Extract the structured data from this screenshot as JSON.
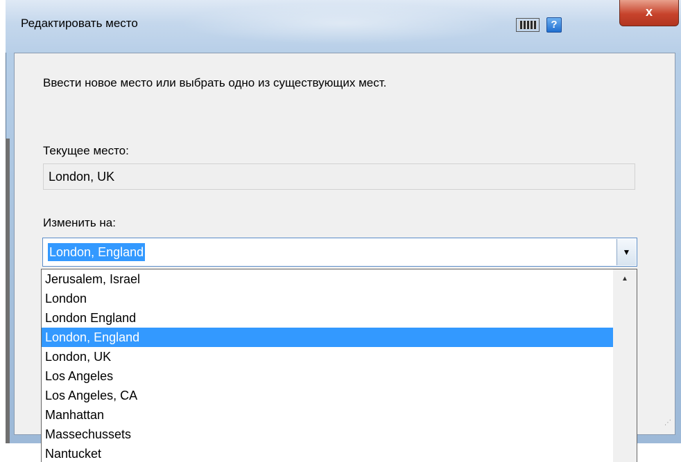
{
  "window": {
    "title": "Редактировать место",
    "close_label": "x",
    "help_label": "?",
    "icons": [
      "keyboard-icon",
      "help-icon",
      "close-icon"
    ]
  },
  "content": {
    "instruction": "Ввести новое место или выбрать одно из существующих мест.",
    "current_label": "Текущее место:",
    "current_value": "London, UK",
    "change_label": "Изменить на:",
    "change_value": "London, England"
  },
  "dropdown": {
    "items": [
      "Jerusalem, Israel",
      "London",
      "London England",
      "London, England",
      "London, UK",
      "Los Angeles",
      "Los Angeles, CA",
      "Manhattan",
      "Massechussets",
      "Nantucket"
    ],
    "selected": "London, England"
  },
  "colors": {
    "selection": "#3399ff",
    "close_button": "#c7432c",
    "frame": "#b9d1ea"
  }
}
